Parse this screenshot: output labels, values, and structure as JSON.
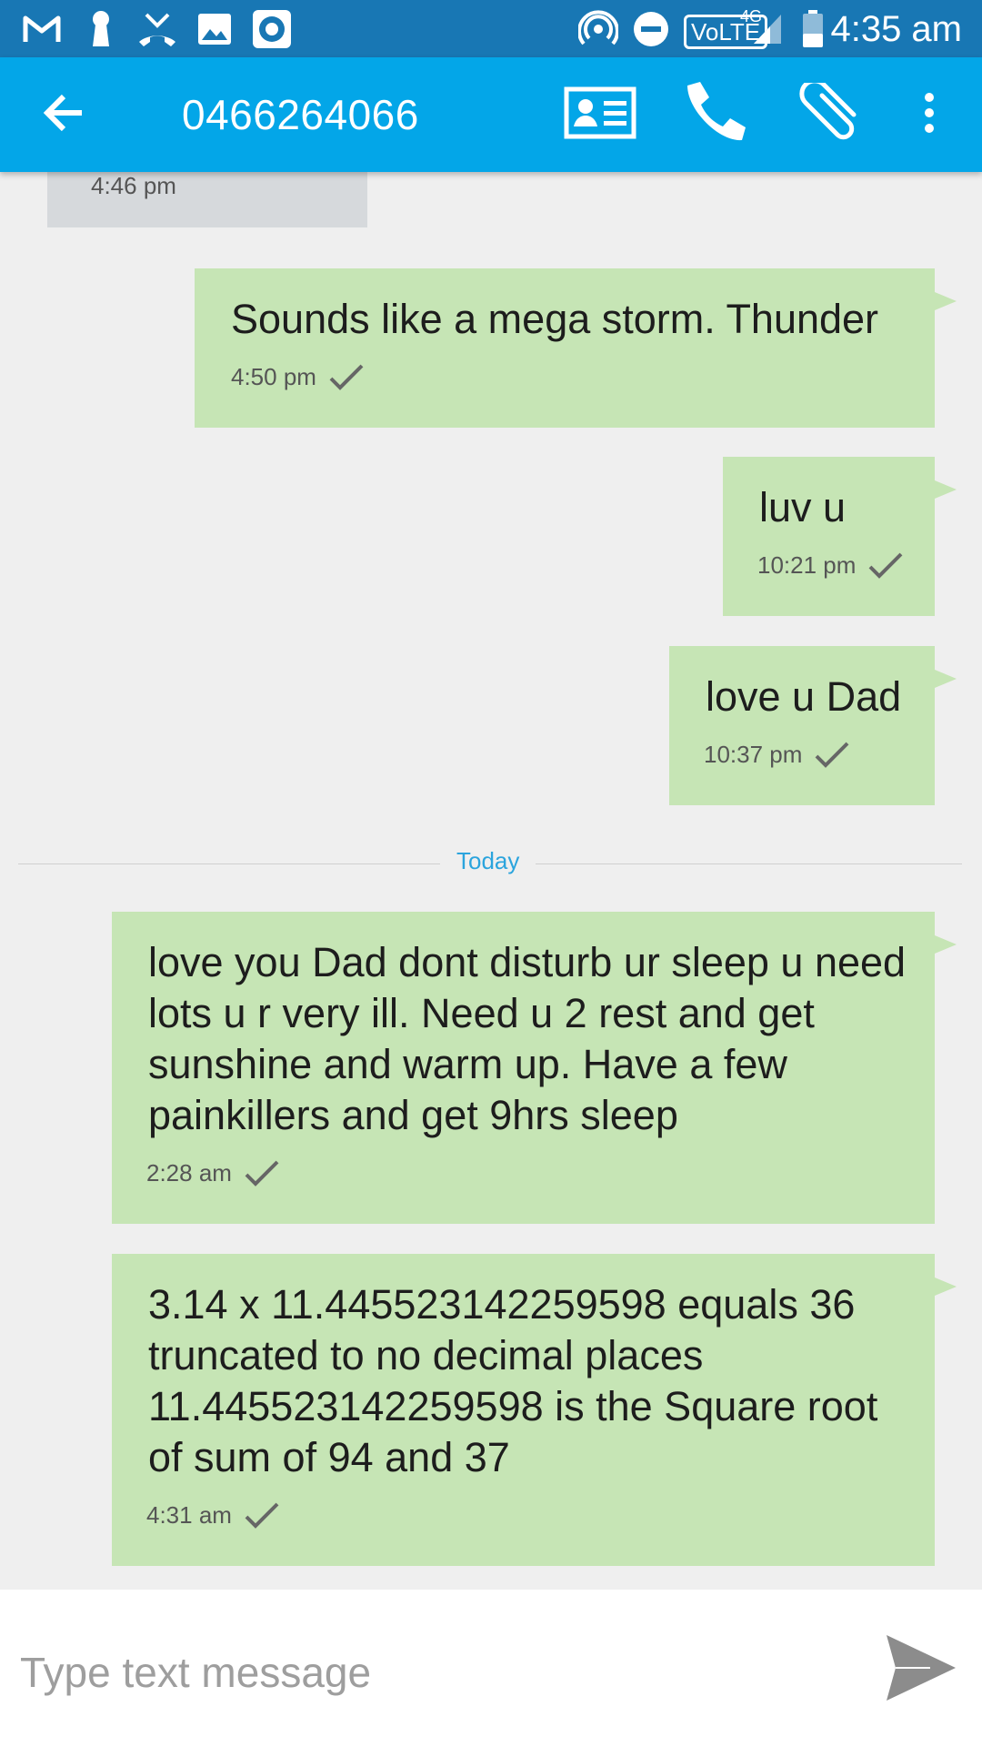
{
  "status_bar": {
    "time": "4:35 am",
    "network_label": "VoLTE",
    "network_gen": "4G",
    "icons": [
      "gmail-icon",
      "keyhole-icon",
      "missed-call-icon",
      "image-icon",
      "record-icon",
      "hotspot-icon",
      "do-not-disturb-icon",
      "signal-icon",
      "battery-icon"
    ]
  },
  "app_bar": {
    "title": "0466264066",
    "icons": [
      "back-arrow-icon",
      "contact-card-icon",
      "phone-icon",
      "paperclip-icon",
      "more-vert-icon"
    ]
  },
  "messages": [
    {
      "direction": "in",
      "text": "",
      "time": "4:46 pm",
      "status": ""
    },
    {
      "direction": "out",
      "text": "Sounds like a mega storm. Thunder",
      "time": "4:50 pm",
      "status": "sent"
    },
    {
      "direction": "out",
      "text": "luv u",
      "time": "10:21 pm",
      "status": "sent"
    },
    {
      "direction": "out",
      "text": "love u Dad",
      "time": "10:37 pm",
      "status": "sent"
    },
    {
      "direction": "out",
      "text": "love you Dad dont disturb ur sleep u need lots u r very ill. Need u 2 rest and get sunshine and warm up. Have a few painkillers and get 9hrs sleep",
      "time": "2:28 am",
      "status": "sent"
    },
    {
      "direction": "out",
      "text": "3.14 x 11.445523142259598 equals 36 truncated to no decimal places 11.445523142259598 is the Square root of sum of 94 and 37",
      "time": "4:31 am",
      "status": "sent"
    }
  ],
  "date_divider": {
    "label": "Today"
  },
  "compose": {
    "placeholder": "Type text message",
    "value": "",
    "send_icon": "send-icon"
  },
  "colors": {
    "status_bar": "#1877b4",
    "app_bar": "#03a6e8",
    "outgoing_bubble": "#c6e5b5",
    "incoming_bubble": "#d6d9dc",
    "divider_label": "#2ba4dd",
    "background": "#efefef"
  }
}
